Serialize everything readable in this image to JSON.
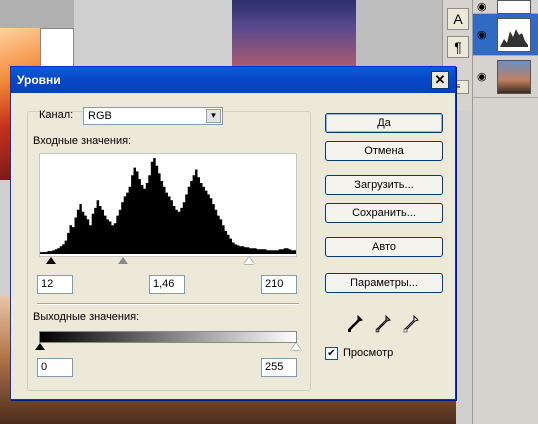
{
  "dialog": {
    "title": "Уровни",
    "close_label": "✕",
    "channel_label": "Канал:",
    "channel_value": "RGB",
    "input_label": "Входные значения:",
    "input_black": "12",
    "input_gamma": "1,46",
    "input_white": "210",
    "output_label": "Выходные значения:",
    "output_black": "0",
    "output_white": "255",
    "buttons": {
      "ok": "Да",
      "cancel": "Отмена",
      "load": "Загрузить...",
      "save": "Сохранить...",
      "auto": "Авто",
      "options": "Параметры..."
    },
    "preview_label": "Просмотр",
    "preview_checked": true
  },
  "toolbar": {
    "text_tool": "A",
    "paragraph_tool": "¶"
  },
  "icons": [
    "close-icon",
    "dropdown-arrow-icon",
    "black-eyedropper-icon",
    "gray-eyedropper-icon",
    "white-eyedropper-icon",
    "eye-icon",
    "checkmark-icon"
  ],
  "histogram": [
    2,
    2,
    2,
    3,
    3,
    4,
    5,
    6,
    8,
    10,
    14,
    22,
    30,
    28,
    38,
    46,
    52,
    44,
    40,
    36,
    30,
    42,
    48,
    56,
    50,
    46,
    40,
    36,
    34,
    30,
    32,
    40,
    46,
    54,
    60,
    64,
    70,
    82,
    90,
    86,
    78,
    72,
    68,
    74,
    82,
    96,
    100,
    92,
    84,
    76,
    70,
    64,
    60,
    56,
    50,
    46,
    44,
    48,
    54,
    62,
    70,
    76,
    82,
    88,
    80,
    74,
    70,
    66,
    62,
    58,
    52,
    46,
    40,
    36,
    30,
    24,
    20,
    16,
    12,
    10,
    9,
    8,
    8,
    7,
    7,
    6,
    6,
    6,
    5,
    5,
    5,
    5,
    4,
    4,
    4,
    4,
    4,
    5,
    5,
    6,
    6,
    5,
    4,
    4
  ]
}
